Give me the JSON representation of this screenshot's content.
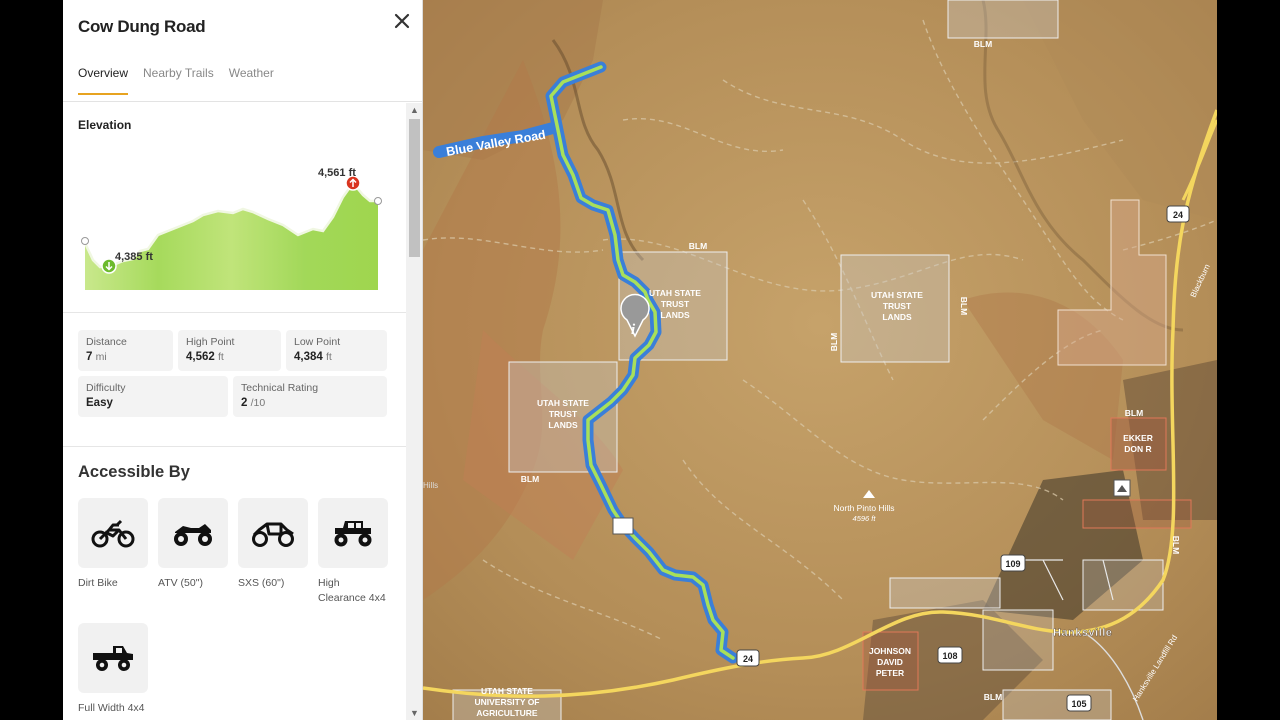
{
  "trail": {
    "title": "Cow Dung Road",
    "tabs": [
      "Overview",
      "Nearby Trails",
      "Weather"
    ]
  },
  "elevation": {
    "title": "Elevation",
    "high_label": "4,561 ft",
    "low_label": "4,385 ft"
  },
  "stats": {
    "distance": {
      "label": "Distance",
      "value": "7",
      "unit": "mi"
    },
    "high_point": {
      "label": "High Point",
      "value": "4,562",
      "unit": "ft"
    },
    "low_point": {
      "label": "Low Point",
      "value": "4,384",
      "unit": "ft"
    },
    "difficulty": {
      "label": "Difficulty",
      "value": "Easy"
    },
    "technical": {
      "label": "Technical Rating",
      "value": "2",
      "unit": "/10"
    }
  },
  "accessible": {
    "title": "Accessible By",
    "vehicles": [
      {
        "label": "Dirt Bike",
        "icon": "dirt-bike-icon"
      },
      {
        "label": "ATV (50\")",
        "icon": "atv-icon"
      },
      {
        "label": "SXS (60\")",
        "icon": "sxs-icon"
      },
      {
        "label": "High Clearance 4x4",
        "icon": "jeep-icon"
      },
      {
        "label": "Full Width 4x4",
        "icon": "truck-icon"
      }
    ]
  },
  "map": {
    "road_label": "Blue Valley Road",
    "parcels": [
      {
        "text": "UTAH STATE\nTRUST\nLANDS"
      },
      {
        "text": "UTAH STATE\nTRUST\nLANDS"
      },
      {
        "text": "UTAH STATE\nTRUST\nLANDS"
      },
      {
        "text": "EKKER\nDON R"
      },
      {
        "text": "JOHNSON\nDAVID\nPETER"
      },
      {
        "text": "UTAH STATE\nUNIVERSITY OF\nAGRICULTURE"
      }
    ],
    "blm": "BLM",
    "peak_name": "North Pinto Hills",
    "peak_elev": "4596 ft",
    "town": "Hanksville",
    "routes": [
      "24",
      "24",
      "109",
      "108",
      "105"
    ],
    "road_names": [
      "Blackburn",
      "Hanksville Landfill Rd"
    ],
    "partial_label": "Hills"
  },
  "colors": {
    "accent": "#e7a320",
    "trail_blue": "#3a7fd9",
    "trail_green": "#a8e05a",
    "highway": "#f2d25a"
  }
}
